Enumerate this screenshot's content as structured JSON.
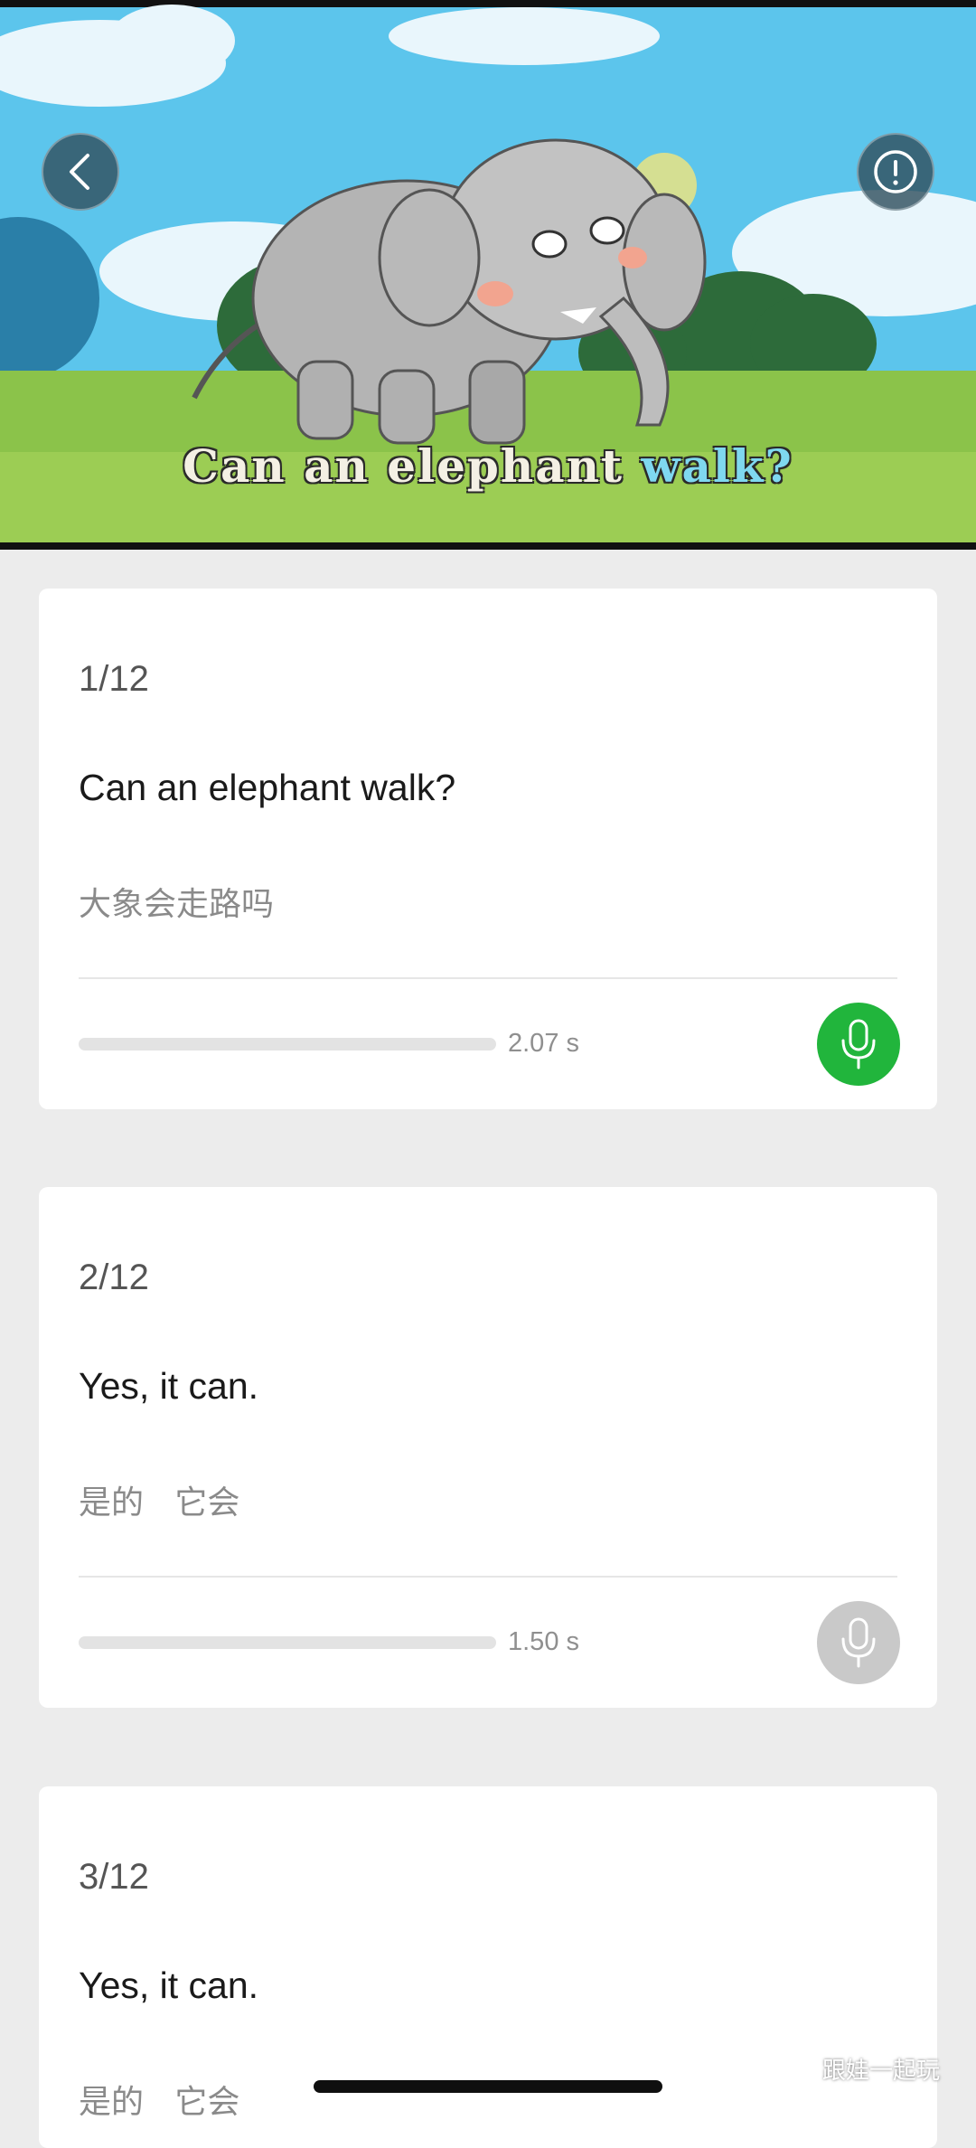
{
  "video": {
    "subtitle_main": "Can an elephant ",
    "subtitle_highlight": "walk?",
    "back_icon": "chevron-left-icon",
    "info_icon": "info-icon"
  },
  "cards": [
    {
      "counter": "1/12",
      "sentence": "Can an elephant walk?",
      "translation": "大象会走路吗",
      "duration": "2.07 s",
      "progress": 0,
      "mic_active": true
    },
    {
      "counter": "2/12",
      "sentence": "Yes, it can.",
      "translation": "是的   它会",
      "duration": "1.50 s",
      "progress": 0,
      "mic_active": false
    },
    {
      "counter": "3/12",
      "sentence": "Yes, it can.",
      "translation": "是的   它会"
    }
  ],
  "colors": {
    "mic_active": "#21b53c",
    "mic_inactive": "#c9c9c9",
    "background": "#ececec"
  },
  "watermark": {
    "text": "跟娃一起玩",
    "icon": "wechat-icon"
  }
}
